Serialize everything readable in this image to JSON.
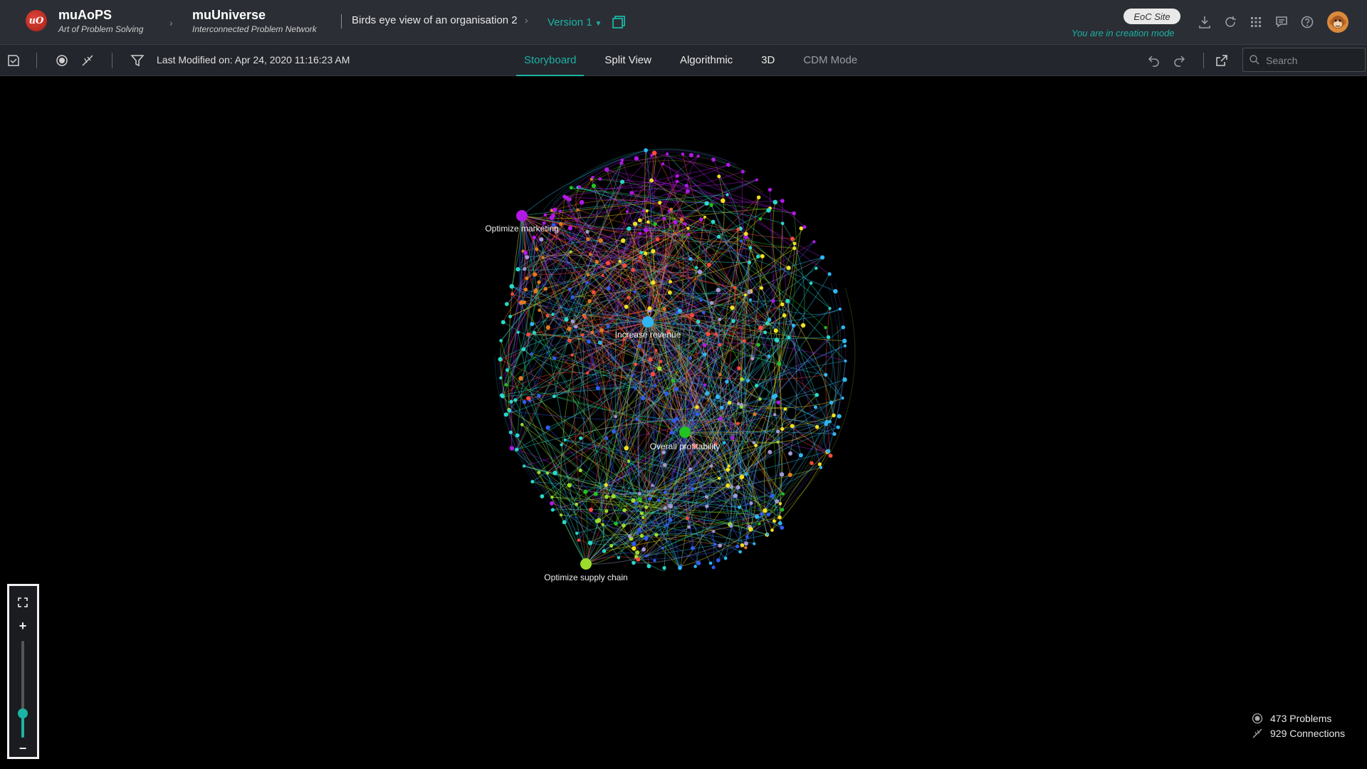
{
  "header": {
    "app_name": "muAoPS",
    "app_subtitle": "Art of Problem Solving",
    "logo_text": "uO",
    "universe_name": "muUniverse",
    "universe_subtitle": "Interconnected Problem Network",
    "map_title": "Birds eye view of an organisation 2",
    "version": "Version 1",
    "eoc_badge": "EoC Site",
    "mode_text": "You are in creation mode",
    "icons": [
      "download-icon",
      "refresh-icon",
      "apps-grid-icon",
      "comments-icon",
      "help-icon",
      "avatar-icon"
    ]
  },
  "toolbar": {
    "last_modified": "Last Modified on: Apr 24, 2020 11:16:23 AM",
    "tabs": [
      "Storyboard",
      "Split View",
      "Algorithmic",
      "3D",
      "CDM Mode"
    ],
    "active_tab": "Storyboard",
    "search_placeholder": "Search",
    "icons": [
      "save-icon",
      "node-icon",
      "connection-icon",
      "filter-icon",
      "undo-icon",
      "redo-icon",
      "share-icon",
      "search-icon"
    ]
  },
  "graph": {
    "hubs": [
      {
        "label": "Optimize marketing",
        "color": "#b218e6"
      },
      {
        "label": "Increase revenue",
        "color": "#2fb6f0"
      },
      {
        "label": "Overall profitability",
        "color": "#22c41f"
      },
      {
        "label": "Optimize supply chain",
        "color": "#9bdc2c"
      }
    ],
    "cluster_colors": [
      "#b218e6",
      "#2fb6f0",
      "#22c41f",
      "#9bdc2c",
      "#f0e020",
      "#2f5cf0",
      "#a39ad8",
      "#e07a20",
      "#ff4a3a",
      "#28d9c8"
    ]
  },
  "zoom": {
    "fit_icon": "fit-screen-icon",
    "zoom_in": "+",
    "zoom_out": "−",
    "level": 0.25
  },
  "stats": {
    "problems": "473 Problems",
    "connections": "929 Connections"
  }
}
